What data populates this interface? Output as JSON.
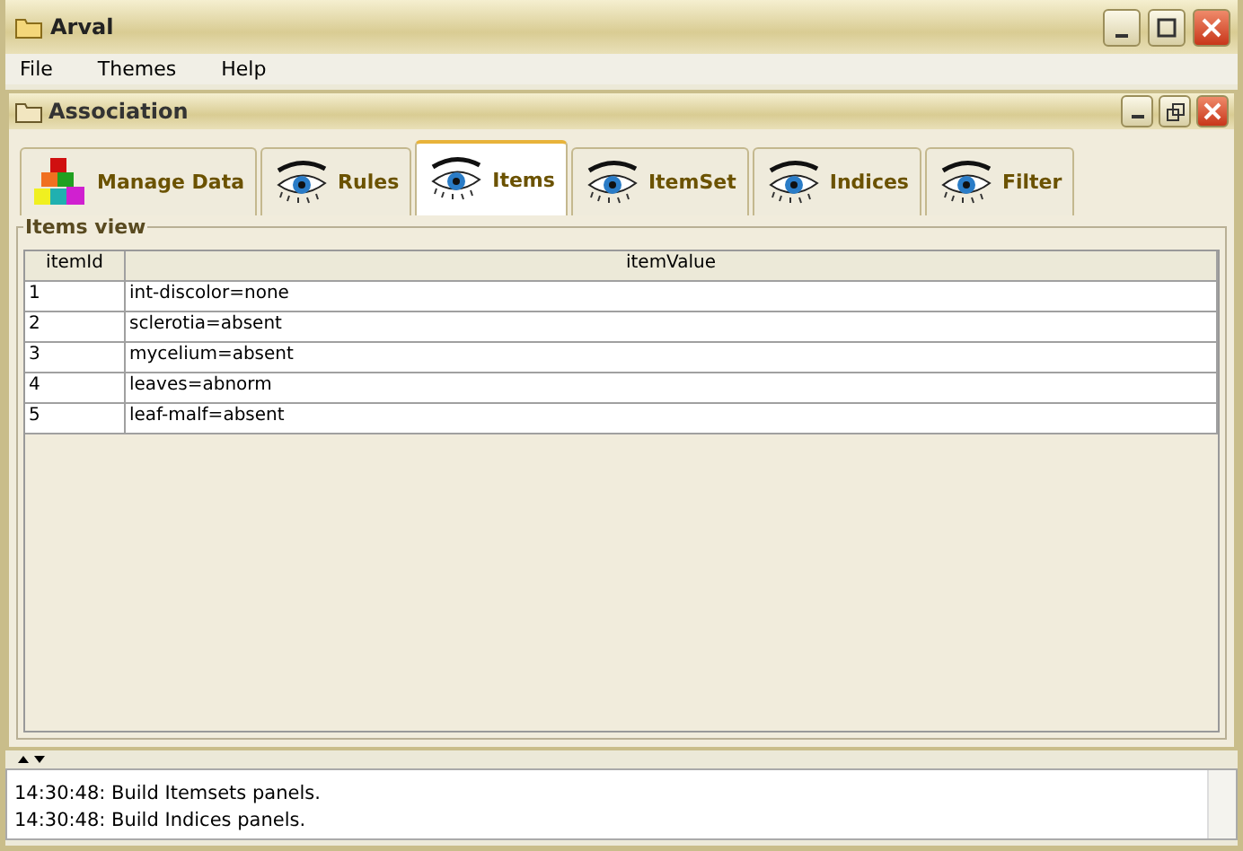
{
  "window": {
    "title": "Arval"
  },
  "menu": [
    "File",
    "Themes",
    "Help"
  ],
  "inner_window": {
    "title": "Association"
  },
  "tabs": [
    {
      "label": "Manage Data",
      "kind": "cubes",
      "selected": false
    },
    {
      "label": "Rules",
      "kind": "eye",
      "selected": false
    },
    {
      "label": "Items",
      "kind": "eye",
      "selected": true
    },
    {
      "label": "ItemSet",
      "kind": "eye",
      "selected": false
    },
    {
      "label": "Indices",
      "kind": "eye",
      "selected": false
    },
    {
      "label": "Filter",
      "kind": "eye",
      "selected": false
    }
  ],
  "panel": {
    "title": "Items view"
  },
  "table": {
    "columns": [
      "itemId",
      "itemValue"
    ],
    "rows": [
      [
        "1",
        "int-discolor=none"
      ],
      [
        "2",
        "sclerotia=absent"
      ],
      [
        "3",
        "mycelium=absent"
      ],
      [
        "4",
        "leaves=abnorm"
      ],
      [
        "5",
        "leaf-malf=absent"
      ]
    ]
  },
  "log": [
    "14:30:48: Build Itemsets panels.",
    "14:30:48: Build Indices panels."
  ]
}
